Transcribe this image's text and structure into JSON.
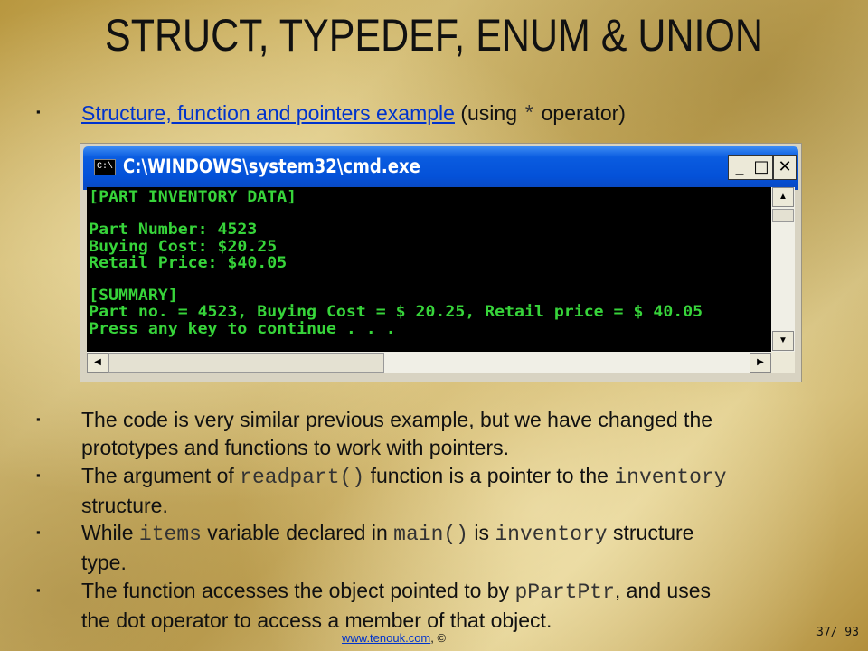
{
  "slide": {
    "title": "STRUCT, TYPEDEF, ENUM & UNION",
    "bullet_glyph": "▪",
    "first_bullet": {
      "link": "Structure, function and pointers example",
      "after_link": " (using ",
      "code": "*",
      "end": " operator)"
    },
    "bullets": [
      {
        "lines": [
          "The code is very similar previous example, but we have changed the",
          "prototypes and functions to work with pointers."
        ]
      },
      {
        "t1": "The argument of ",
        "c1": "readpart()",
        "t2": " function is a pointer to the ",
        "c2": "inventory",
        "t3": "structure."
      },
      {
        "t1": "While ",
        "c1": "items",
        "t2": " variable declared in ",
        "c2": "main()",
        "t3": " is ",
        "c3": "inventory",
        "t4": " structure",
        "t5": "type."
      },
      {
        "t1": "The function accesses the object pointed to by ",
        "c1": "pPartPtr",
        "t2": ", and uses",
        "t3": "the dot operator to access a member of that object."
      }
    ],
    "footer": {
      "link": "www.tenouk.com",
      "suffix": ", ©"
    },
    "page_number": "37/ 93"
  },
  "window": {
    "title": "C:\\WINDOWS\\system32\\cmd.exe",
    "icon_label": "C:\\",
    "buttons": {
      "minimize": "_",
      "maximize": "□",
      "close": "✕"
    },
    "console_lines": [
      "[PART INVENTORY DATA]",
      "",
      "Part Number: 4523",
      "Buying Cost: $20.25",
      "Retail Price: $40.05",
      "",
      "[SUMMARY]",
      "Part no. = 4523, Buying Cost = $ 20.25, Retail price = $ 40.05",
      "Press any key to continue . . ."
    ],
    "scroll": {
      "up": "▲",
      "down": "▼",
      "left": "◀",
      "right": "▶"
    }
  },
  "colors": {
    "console_text": "#37d43a",
    "link": "#0033cc",
    "titlebar": "#0451d8"
  }
}
